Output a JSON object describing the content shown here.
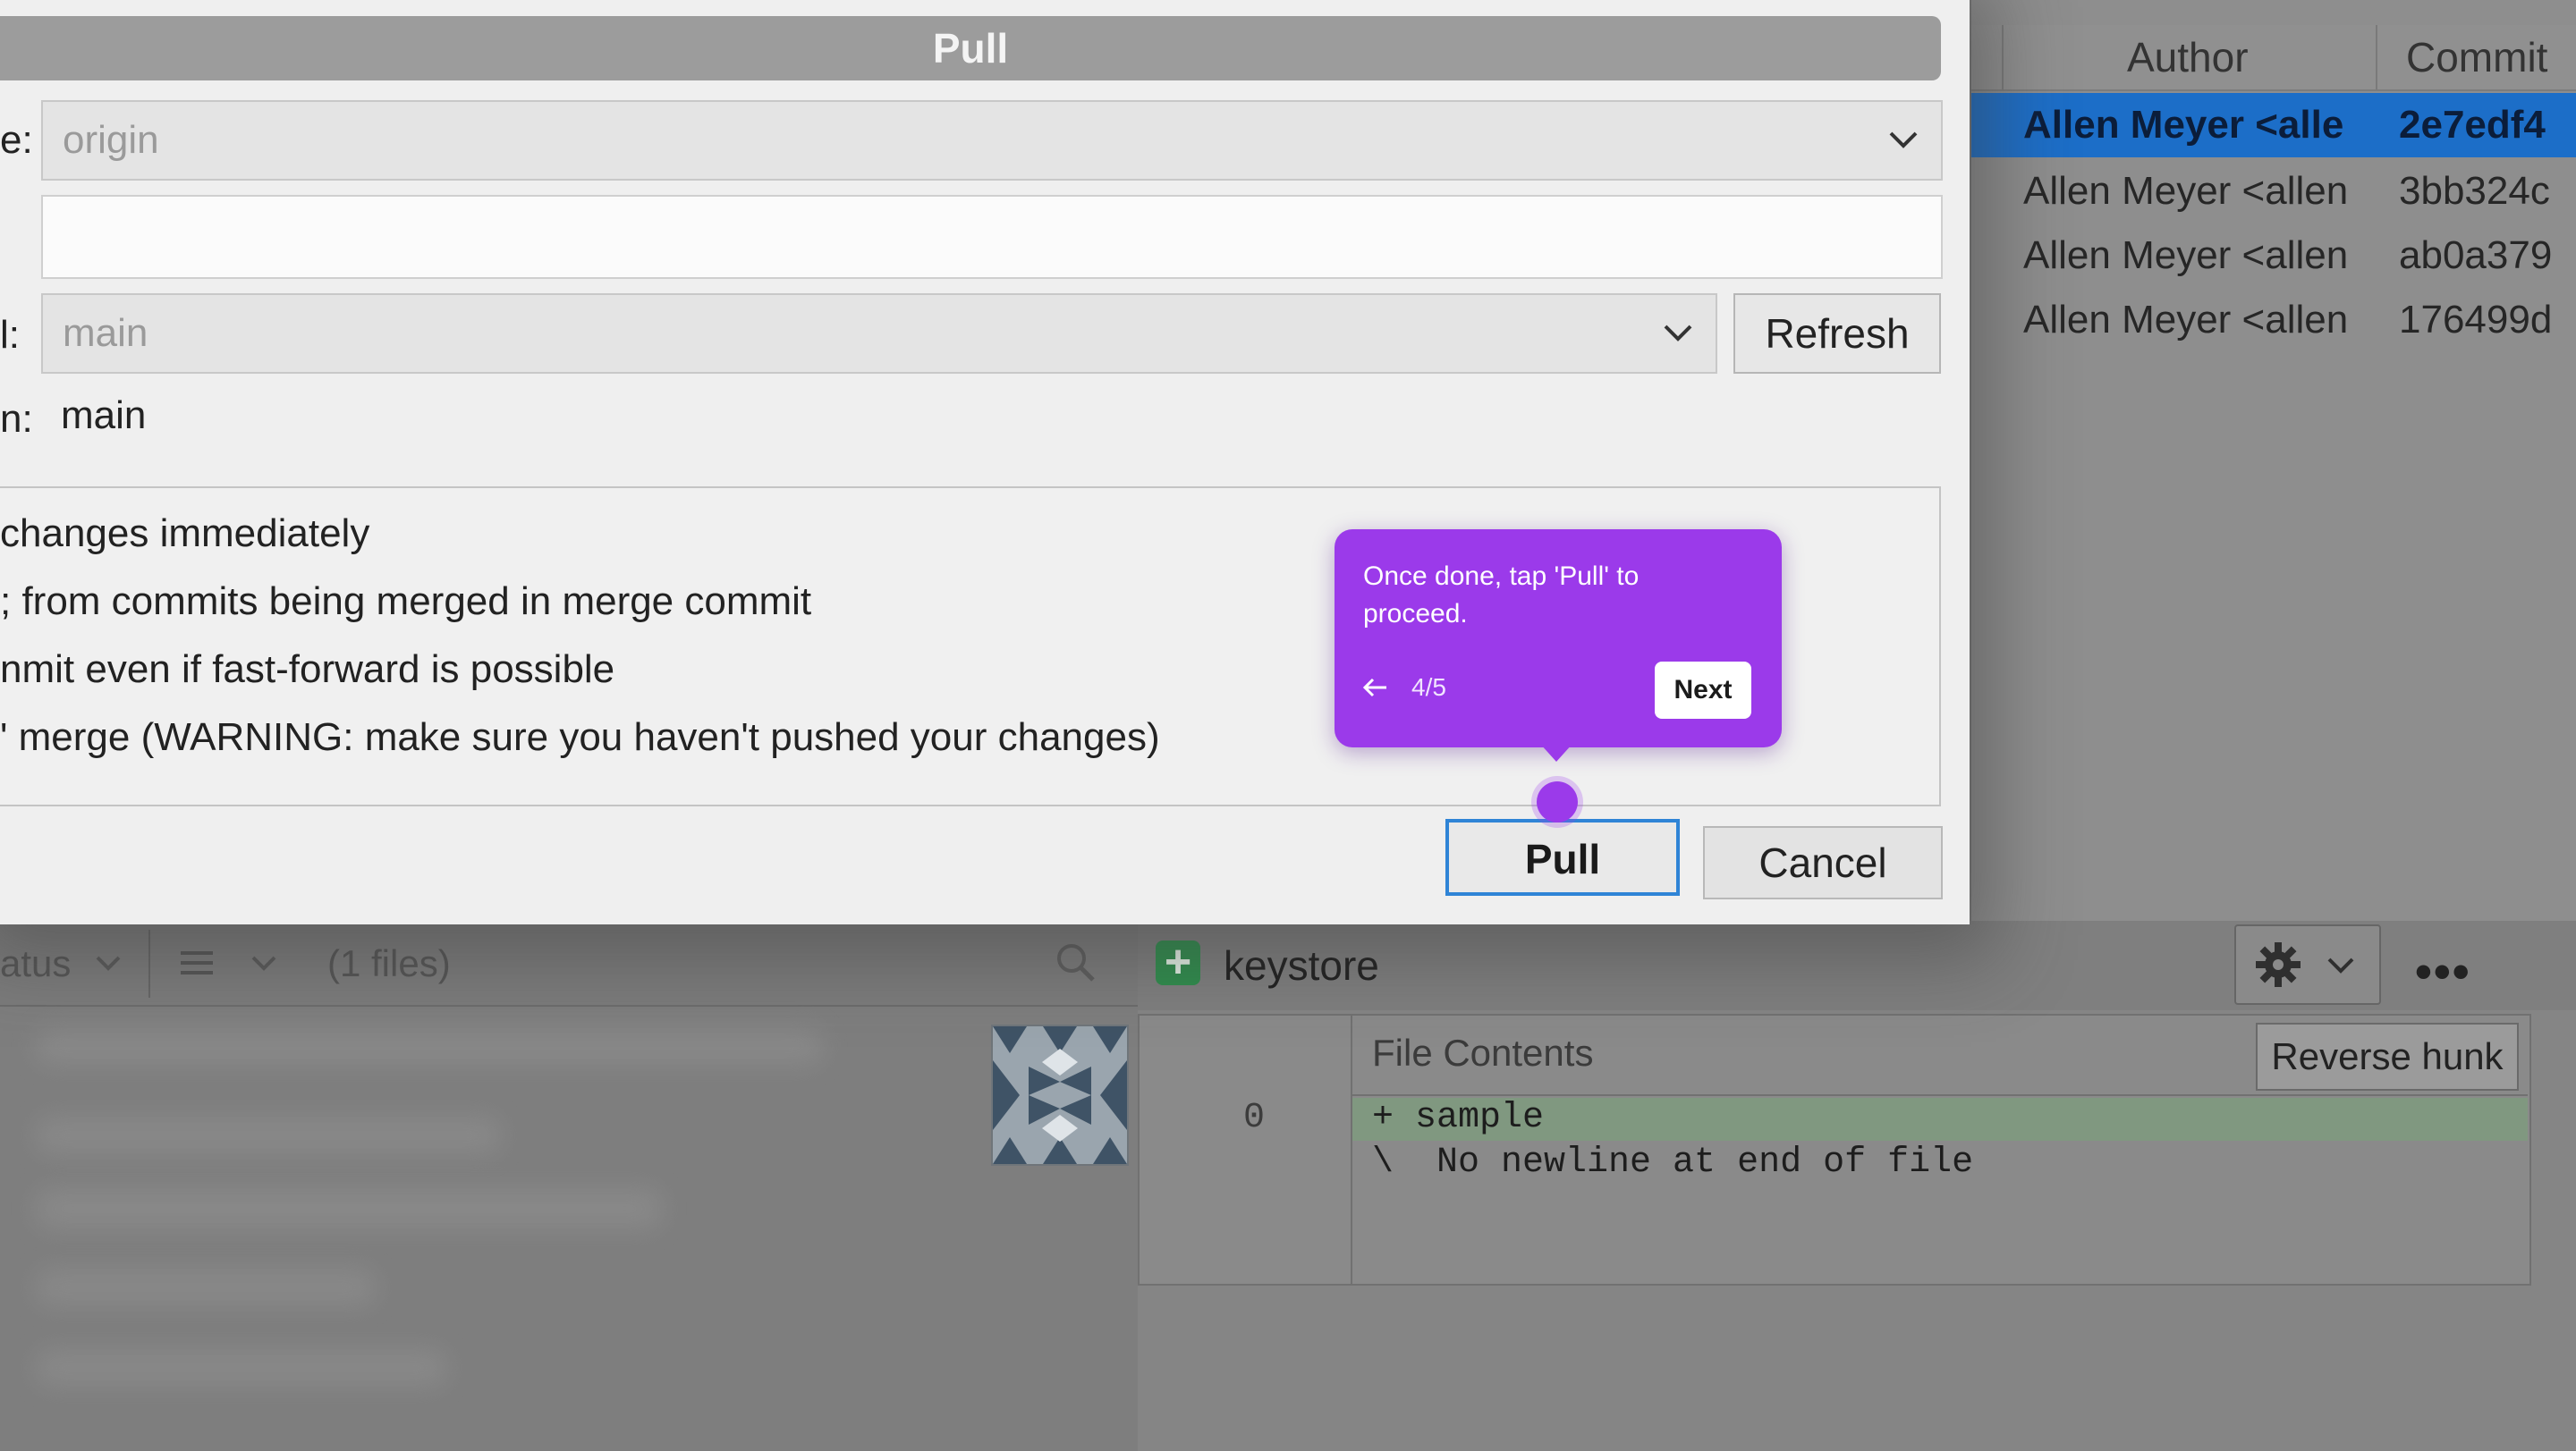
{
  "dialog": {
    "title": "Pull",
    "remote_label": "e:",
    "remote_value": "origin",
    "remote_branch_label": "l:",
    "remote_branch_value": "main",
    "refresh_label": "Refresh",
    "local_label": "n:",
    "local_value": "main",
    "options": [
      "changes immediately",
      "; from commits being merged in merge commit",
      "nmit even if fast-forward is possible",
      "' merge (WARNING: make sure you haven't pushed your changes)"
    ],
    "pull_label": "Pull",
    "cancel_label": "Cancel"
  },
  "commits": {
    "columns": [
      "Author",
      "Commit"
    ],
    "rows": [
      {
        "author": "Allen Meyer <alle",
        "hash": "2e7edf4"
      },
      {
        "author": "Allen Meyer <allen",
        "hash": "3bb324c"
      },
      {
        "author": "Allen Meyer <allen",
        "hash": "ab0a379"
      },
      {
        "author": "Allen Meyer <allen",
        "hash": "176499d"
      }
    ]
  },
  "files_toolbar": {
    "sort_label": "atus",
    "count_label": "(1 files)"
  },
  "diff": {
    "file_name": "keystore",
    "file_contents_label": "File Contents",
    "reverse_hunk_label": "Reverse hunk",
    "line_number": "0",
    "added_line": "+ sample",
    "note_line": "\\  No newline at end of file"
  },
  "tooltip": {
    "text": "Once done, tap 'Pull' to proceed.",
    "step": "4/5",
    "next_label": "Next",
    "color": "#9b3aea"
  }
}
